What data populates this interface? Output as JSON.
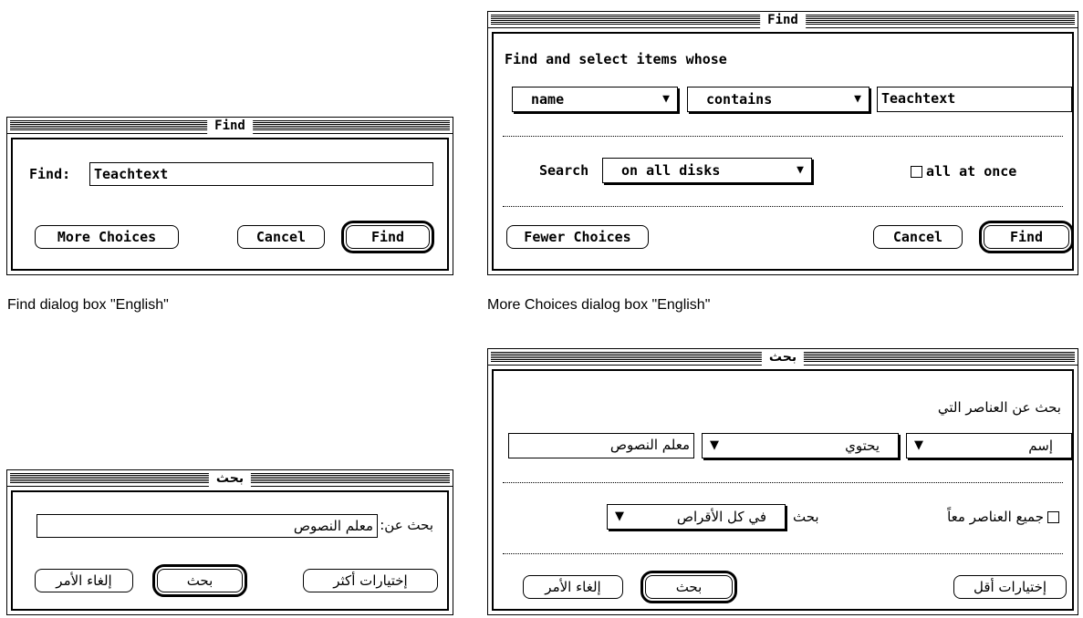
{
  "d1": {
    "title": "Find",
    "find_label": "Find:",
    "find_value": "Teachtext",
    "more_button": "More Choices",
    "cancel_button": "Cancel",
    "find_button": "Find",
    "caption": "Find dialog box \"English\""
  },
  "d2": {
    "title": "Find",
    "heading": "Find and select items whose",
    "field_popup": "name",
    "op_popup": "contains",
    "value": "Teachtext",
    "search_label": "Search",
    "search_popup": "on all disks",
    "all_at_once": "all at once",
    "fewer_button": "Fewer Choices",
    "cancel_button": "Cancel",
    "find_button": "Find",
    "caption": "More Choices dialog box \"English\""
  },
  "d3": {
    "title": "بحث",
    "find_label": "بحث عن:",
    "find_value": "معلم النصوص",
    "more_button": "إختيارات أكثر",
    "find_button": "بحث",
    "cancel_button": "إلغاء الأمر"
  },
  "d4": {
    "title": "بحث",
    "heading": "بحث عن العناصر التي",
    "field_popup": "إسم",
    "op_popup": "يحتوي",
    "value": "معلم النصوص",
    "search_label": "بحث",
    "search_popup": "في كل الأقراص",
    "all_at_once": "جميع العناصر معاً",
    "fewer_button": "إختيارات أقل",
    "find_button": "بحث",
    "cancel_button": "إلغاء الأمر"
  }
}
